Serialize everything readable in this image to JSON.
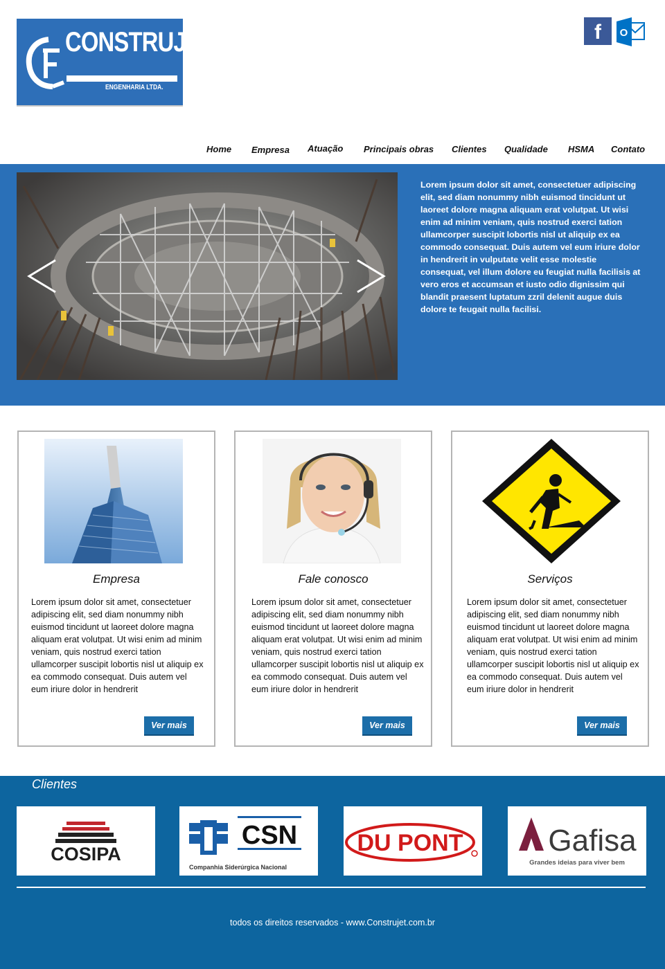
{
  "brand": {
    "name": "CONSTRUJET",
    "tagline": "ENGENHARIA LTDA.",
    "color": "#2e6fb8"
  },
  "social": {
    "facebook_glyph": "f",
    "outlook_glyph": "O"
  },
  "nav": {
    "items": [
      "Home",
      "Empresa",
      "Atuação",
      "Principais obras",
      "Clientes",
      "Qualidade",
      "HSMA",
      "Contato"
    ]
  },
  "hero": {
    "text": "Lorem ipsum dolor sit amet, consectetuer adipiscing elit, sed diam nonummy nibh euismod tincidunt ut laoreet dolore magna aliquam erat volutpat. Ut wisi enim ad minim veniam, quis nostrud exerci tation ullamcorper suscipit lobortis nisl ut aliquip ex ea commodo consequat. Duis autem vel eum iriure dolor in hendrerit in vulputate velit esse molestie consequat, vel illum dolore eu feugiat nulla facilisis at vero eros et accumsan et iusto odio dignissim qui blandit praesent luptatum zzril delenit augue duis dolore te feugait nulla facilisi.",
    "bg_color": "#2a70b8"
  },
  "cards": [
    {
      "title": "Empresa",
      "text": "Lorem ipsum dolor sit amet, consectetuer adipiscing elit, sed diam nonummy nibh euismod tincidunt ut laoreet dolore magna aliquam erat volutpat. Ut wisi enim ad minim veniam, quis nostrud exerci tation ullamcorper suscipit lobortis nisl ut aliquip ex ea commodo consequat. Duis autem vel eum iriure dolor in hendrerit",
      "button": "Ver mais"
    },
    {
      "title": "Fale conosco",
      "text": "Lorem ipsum dolor sit amet, consectetuer adipiscing elit, sed diam nonummy nibh euismod tincidunt ut laoreet dolore magna aliquam erat volutpat. Ut wisi enim ad minim veniam, quis nostrud exerci tation ullamcorper suscipit lobortis nisl ut aliquip ex ea commodo consequat. Duis autem vel eum iriure dolor in hendrerit",
      "button": "Ver mais"
    },
    {
      "title": "Serviços",
      "text": "Lorem ipsum dolor sit amet, consectetuer adipiscing elit, sed diam nonummy nibh euismod tincidunt ut laoreet dolore magna aliquam erat volutpat. Ut wisi enim ad minim veniam, quis nostrud exerci tation ullamcorper suscipit lobortis nisl ut aliquip ex ea commodo consequat. Duis autem vel eum iriure dolor in hendrerit",
      "button": "Ver mais"
    }
  ],
  "clients": {
    "title": "Clientes",
    "logos": [
      {
        "name": "COSIPA"
      },
      {
        "name": "CSN",
        "subtitle": "Companhia Siderúrgica Nacional"
      },
      {
        "name": "DU PONT"
      },
      {
        "name": "Gafisa",
        "subtitle": "Grandes ideias para viver bem"
      }
    ]
  },
  "footer": {
    "copyright": "todos os direitos reservados - www.Construjet.com.br",
    "bg_color": "#0d659f"
  }
}
